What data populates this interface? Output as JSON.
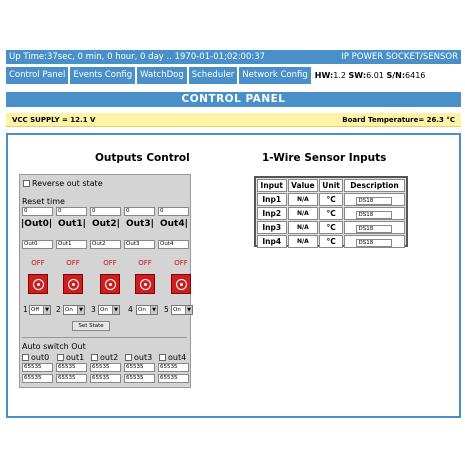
{
  "status": {
    "uptime": "Up Time:37sec, 0 min, 0 hour, 0 day .. 1970-01-01;02:00:37",
    "device": "IP POWER SOCKET/SENSOR"
  },
  "nav": {
    "items": [
      "Control Panel",
      "Events Config",
      "WatchDog",
      "Scheduler",
      "Network Config"
    ],
    "hw_label": "HW:",
    "hw": "1.2",
    "sw_label": "SW:",
    "sw": "6.01",
    "sn_label": "S/N:",
    "sn": "6416"
  },
  "page_title": "CONTROL PANEL",
  "supply": {
    "vcc": "VCC SUPPLY = 12.1 V",
    "board_temp": "Board Temperature= 26.3 °C"
  },
  "outputs": {
    "title": "Outputs Control",
    "reverse_label": "Reverse out state",
    "reset_time_label": "Reset time",
    "reset_values": [
      "0",
      "0",
      "0",
      "0",
      "0"
    ],
    "headers": [
      "|Out0|",
      "Out1|",
      "Out2|",
      "Out3|",
      "Out4|"
    ],
    "names": [
      "Out0",
      "Out1",
      "Out2",
      "Out3",
      "Out4"
    ],
    "state_labels": [
      "OFF",
      "OFF",
      "OFF",
      "OFF",
      "OFF"
    ],
    "select_numbers": [
      "1",
      "2",
      "3",
      "4",
      "5"
    ],
    "select_values": [
      "Off",
      "On",
      "On",
      "On",
      "On"
    ],
    "set_state_label": "Set State",
    "auto_switch_label": "Auto switch Out",
    "auto_checks": [
      "out0",
      "out1",
      "out2",
      "out3",
      "out4"
    ],
    "auto_row1": [
      "65535",
      "65535",
      "65535",
      "65535",
      "65535"
    ],
    "auto_row2": [
      "65535",
      "65535",
      "65535",
      "65535",
      "65535"
    ]
  },
  "sensors": {
    "title": "1-Wire Sensor Inputs",
    "columns": [
      "Input",
      "Value",
      "Unit",
      "Description"
    ],
    "rows": [
      {
        "input": "Inp1",
        "value": "N/A",
        "unit": "°C",
        "desc": "DS18"
      },
      {
        "input": "Inp2",
        "value": "N/A",
        "unit": "°C",
        "desc": "DS18"
      },
      {
        "input": "Inp3",
        "value": "N/A",
        "unit": "°C",
        "desc": "DS18"
      },
      {
        "input": "Inp4",
        "value": "N/A",
        "unit": "°C",
        "desc": "DS18"
      }
    ]
  },
  "colors": {
    "accent": "#4a90c8",
    "supply_bg": "#fff3a8",
    "power_red": "#cc2020"
  }
}
